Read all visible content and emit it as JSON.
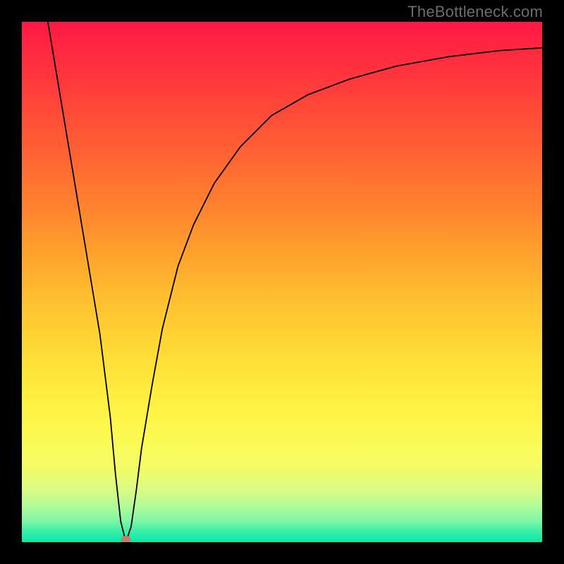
{
  "watermark": "TheBottleneck.com",
  "chart_data": {
    "type": "line",
    "title": "",
    "xlabel": "",
    "ylabel": "",
    "xlim": [
      0,
      100
    ],
    "ylim": [
      0,
      100
    ],
    "grid": false,
    "legend": false,
    "marker": {
      "x": 20,
      "y": 0,
      "color": "#c97a6a"
    },
    "series": [
      {
        "name": "curve",
        "color": "#000000",
        "x": [
          5,
          7,
          9,
          11,
          13,
          15,
          17,
          18,
          19,
          20,
          21,
          22,
          23,
          25,
          27,
          30,
          33,
          37,
          42,
          48,
          55,
          63,
          72,
          82,
          92,
          100
        ],
        "y": [
          100,
          88,
          76,
          64,
          52,
          40,
          24,
          13,
          4,
          0,
          3,
          10,
          18,
          30,
          41,
          53,
          61,
          69,
          76,
          82,
          86,
          89,
          91.5,
          93.3,
          94.5,
          95
        ]
      }
    ]
  }
}
